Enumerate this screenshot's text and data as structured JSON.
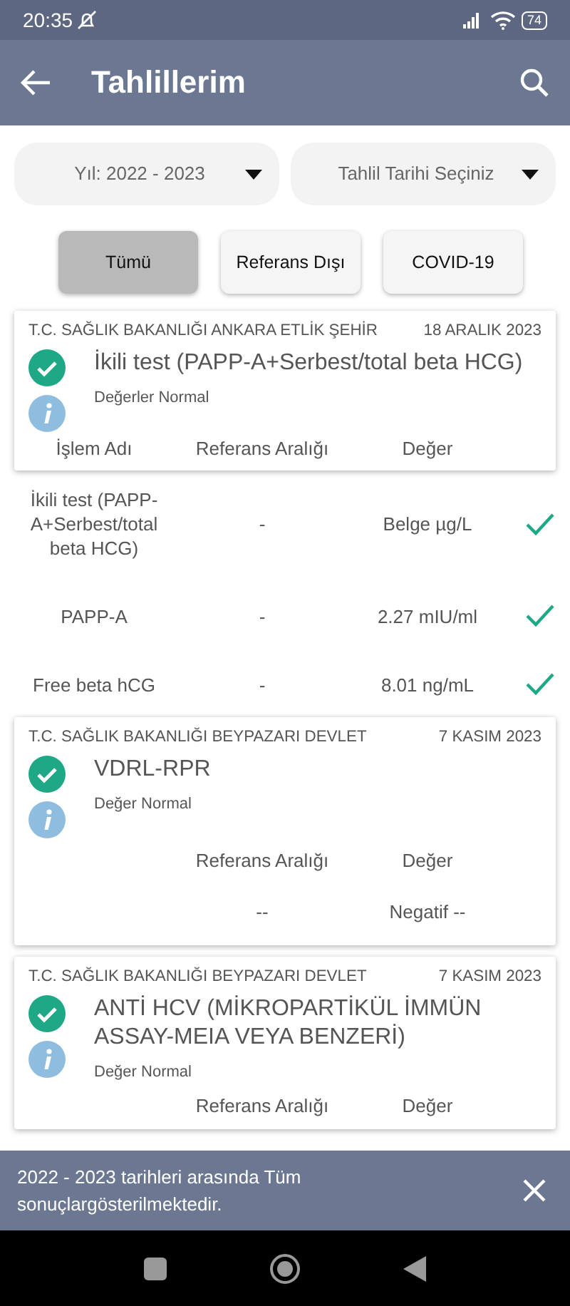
{
  "status_bar": {
    "time": "20:35",
    "battery": "74"
  },
  "app_bar": {
    "title": "Tahlillerim"
  },
  "filters": [
    {
      "text": "Yıl: 2022 - 2023"
    },
    {
      "text": "Tahlil Tarihi Seçiniz"
    }
  ],
  "chips": [
    {
      "label": "Tümü",
      "selected": true
    },
    {
      "label": "Referans Dışı",
      "selected": false
    },
    {
      "label": "COVID-19",
      "selected": false
    }
  ],
  "results": [
    {
      "hospital": "T.C. SAĞLIK BAKANLIĞI ANKARA ETLİK ŞEHİR",
      "date": "18 ARALIK 2023",
      "test": "İkili test (PAPP-A+Serbest/total beta HCG)",
      "status": "Değerler Normal",
      "header": {
        "name": "İşlem Adı",
        "reference": "Referans Aralığı",
        "value": "Değer"
      },
      "rows_in_card": false,
      "rows": [
        {
          "name": "İkili test (PAPP-A+Serbest/total beta HCG)",
          "reference": "-",
          "value": "Belge µg/L",
          "ok": true
        },
        {
          "name": "PAPP-A",
          "reference": "-",
          "value": "2.27 mIU/ml",
          "ok": true
        },
        {
          "name": "Free beta hCG",
          "reference": "-",
          "value": "8.01 ng/mL",
          "ok": true
        }
      ]
    },
    {
      "hospital": "T.C. SAĞLIK BAKANLIĞI BEYPAZARI DEVLET",
      "date": "7 KASIM 2023",
      "test": "VDRL-RPR",
      "status": "Değer Normal",
      "header": {
        "reference": "Referans Aralığı",
        "value": "Değer"
      },
      "rows_in_card": true,
      "rows": [
        {
          "reference": "--",
          "value": "Negatif --",
          "ok": false
        }
      ]
    },
    {
      "hospital": "T.C. SAĞLIK BAKANLIĞI BEYPAZARI DEVLET",
      "date": "7 KASIM 2023",
      "test": "ANTİ HCV (MİKROPARTİKÜL İMMÜN ASSAY-MEIA VEYA BENZERİ)",
      "status": "Değer Normal",
      "header": {
        "reference": "Referans Aralığı",
        "value": "Değer"
      },
      "rows_in_card": true
    }
  ],
  "snackbar": {
    "text": "2022 - 2023 tarihleri arasında Tüm sonuçlargösterilmektedir."
  }
}
